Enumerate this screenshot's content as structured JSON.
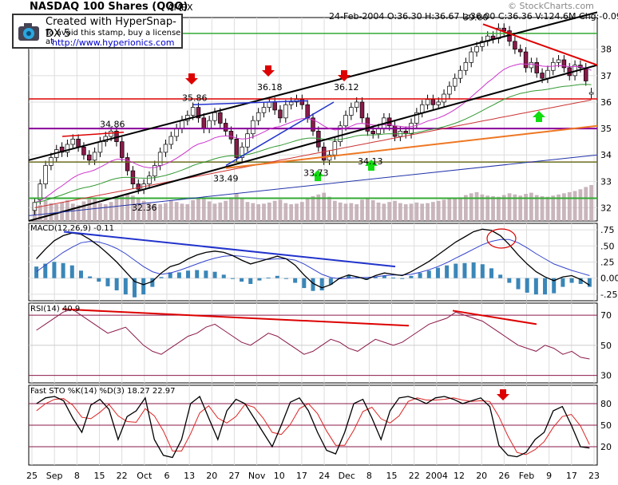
{
  "header": {
    "title": "NASDAQ 100 Shares (QQQ)",
    "exchange": "AMEX",
    "quote": "24-Feb-2004 O:36.30 H:36.67 L:36.00 C:36.36 V:124.6M Chg:-0.09",
    "copyright": "© StockCharts.com"
  },
  "stamp": {
    "line1": "Created with HyperSnap-DX 5",
    "line2": "To avoid this stamp, buy a license at",
    "line3": "http://www.hyperionics.com"
  },
  "colors": {
    "up": "#ffffff",
    "down": "#8b1a4a",
    "candle_border": "#000000",
    "ema20": "#cc33cc",
    "ema50": "#339933",
    "ema200": "#cc3333",
    "red_line": "#dd0000",
    "purple_line": "#880099",
    "green_line": "#33aa33",
    "orange_line": "#ee7722",
    "blue_line": "#2233cc",
    "arrow_down": "#dd0000",
    "arrow_up": "#11dd11",
    "volume": "#c0a8b0",
    "hist": "#3a86b8"
  },
  "chart_data": [
    {
      "type": "candlestick",
      "title": "NASDAQ 100 Shares (QQQ)",
      "ylim": [
        31.5,
        39.2
      ],
      "yticks": [
        32,
        33,
        34,
        35,
        36,
        37,
        38
      ],
      "x_labels": [
        "25",
        "Sep",
        "8",
        "15",
        "22",
        "Oct",
        "6",
        "13",
        "20",
        "27",
        "Nov",
        "10",
        "17",
        "24",
        "Dec",
        "8",
        "15",
        "22",
        "2004",
        "12",
        "20",
        "26",
        "Feb",
        "9",
        "17",
        "23"
      ],
      "annotations": [
        "34.86",
        "35.86",
        "36.18",
        "36.12",
        "39.00",
        "33.49",
        "33.73",
        "34.13",
        "32.36"
      ],
      "series": [
        {
          "name": "close",
          "values": [
            32.2,
            32.9,
            33.6,
            33.9,
            34.2,
            34.1,
            34.4,
            34.6,
            34.3,
            34.0,
            33.8,
            34.1,
            34.5,
            34.7,
            34.9,
            34.5,
            33.9,
            33.4,
            32.9,
            32.7,
            32.9,
            33.2,
            33.6,
            34.1,
            34.4,
            34.7,
            35.0,
            35.3,
            35.5,
            35.8,
            35.4,
            35.0,
            35.3,
            35.6,
            35.2,
            34.9,
            34.6,
            33.9,
            34.3,
            34.8,
            35.3,
            35.6,
            35.8,
            36.0,
            35.7,
            35.4,
            35.9,
            36.0,
            36.1,
            35.9,
            35.4,
            34.9,
            34.3,
            33.8,
            34.0,
            34.5,
            35.1,
            35.5,
            35.8,
            36.0,
            35.4,
            34.9,
            34.8,
            35.0,
            35.4,
            35.1,
            34.7,
            34.9,
            34.8,
            35.2,
            35.6,
            35.9,
            36.1,
            35.9,
            36.0,
            36.3,
            36.6,
            36.9,
            37.2,
            37.5,
            37.9,
            38.1,
            38.3,
            38.5,
            38.4,
            38.8,
            38.7,
            38.3,
            38.0,
            37.9,
            37.3,
            37.5,
            37.1,
            36.9,
            37.2,
            37.5,
            37.6,
            37.3,
            37.0,
            37.4,
            37.3,
            36.8,
            36.36
          ]
        },
        {
          "name": "open",
          "values": [
            31.9,
            32.3,
            32.9,
            33.6,
            33.9,
            34.3,
            34.1,
            34.4,
            34.6,
            34.3,
            34.0,
            33.8,
            34.1,
            34.5,
            34.7,
            34.9,
            34.5,
            33.9,
            33.4,
            32.9,
            32.7,
            32.9,
            33.2,
            33.6,
            34.1,
            34.4,
            34.7,
            35.0,
            35.3,
            35.5,
            35.8,
            35.4,
            35.0,
            35.3,
            35.6,
            35.2,
            34.9,
            34.6,
            33.9,
            34.3,
            34.8,
            35.3,
            35.6,
            35.8,
            36.0,
            35.7,
            35.4,
            35.9,
            36.0,
            36.1,
            35.9,
            35.4,
            34.9,
            34.3,
            33.8,
            34.0,
            34.5,
            35.1,
            35.5,
            35.8,
            36.0,
            35.4,
            34.9,
            34.8,
            35.0,
            35.4,
            35.1,
            34.7,
            34.9,
            34.8,
            35.2,
            35.6,
            35.9,
            36.1,
            35.9,
            36.0,
            36.3,
            36.6,
            36.9,
            37.2,
            37.5,
            37.9,
            38.1,
            38.3,
            38.5,
            38.4,
            38.8,
            38.7,
            38.3,
            38.0,
            37.9,
            37.3,
            37.5,
            37.1,
            36.9,
            37.2,
            37.5,
            37.6,
            37.3,
            37.0,
            37.4,
            37.3,
            36.3
          ]
        },
        {
          "name": "volume_m",
          "values": [
            60,
            55,
            70,
            62,
            58,
            65,
            72,
            60,
            55,
            68,
            75,
            80,
            62,
            58,
            66,
            85,
            90,
            95,
            88,
            78,
            70,
            64,
            60,
            58,
            62,
            70,
            66,
            60,
            58,
            72,
            80,
            76,
            68,
            60,
            64,
            70,
            82,
            95,
            80,
            66,
            62,
            58,
            60,
            64,
            70,
            74,
            62,
            58,
            60,
            66,
            78,
            86,
            92,
            98,
            84,
            70,
            64,
            60,
            62,
            58,
            74,
            80,
            72,
            64,
            60,
            66,
            70,
            62,
            58,
            60,
            64,
            60,
            62,
            66,
            70,
            74,
            78,
            80,
            82,
            90,
            96,
            100,
            92,
            88,
            86,
            84,
            90,
            96,
            92,
            88,
            94,
            98,
            90,
            86,
            84,
            88,
            92,
            96,
            100,
            104,
            110,
            118,
            124.6
          ]
        }
      ]
    },
    {
      "type": "line",
      "title": "MACD(12,26,9) -0.11",
      "ylim": [
        -0.35,
        0.85
      ],
      "yticks": [
        ".75",
        ".50",
        ".25",
        "0.00",
        "-.25"
      ],
      "series": [
        {
          "name": "MACD",
          "values": [
            0.3,
            0.45,
            0.58,
            0.66,
            0.7,
            0.68,
            0.6,
            0.5,
            0.38,
            0.25,
            0.1,
            -0.05,
            -0.1,
            -0.05,
            0.08,
            0.18,
            0.22,
            0.3,
            0.36,
            0.4,
            0.42,
            0.4,
            0.35,
            0.28,
            0.22,
            0.26,
            0.3,
            0.34,
            0.3,
            0.2,
            0.05,
            -0.08,
            -0.15,
            -0.1,
            0.0,
            0.05,
            0.02,
            -0.02,
            0.04,
            0.08,
            0.06,
            0.04,
            0.1,
            0.18,
            0.26,
            0.36,
            0.46,
            0.56,
            0.64,
            0.72,
            0.76,
            0.74,
            0.66,
            0.52,
            0.36,
            0.22,
            0.1,
            0.02,
            -0.04,
            0.02,
            0.04,
            -0.02,
            -0.11
          ]
        },
        {
          "name": "Signal",
          "values": [
            0.1,
            0.2,
            0.3,
            0.4,
            0.48,
            0.55,
            0.57,
            0.56,
            0.52,
            0.46,
            0.38,
            0.28,
            0.18,
            0.1,
            0.06,
            0.08,
            0.12,
            0.17,
            0.22,
            0.27,
            0.31,
            0.34,
            0.35,
            0.34,
            0.32,
            0.3,
            0.29,
            0.3,
            0.3,
            0.28,
            0.22,
            0.14,
            0.06,
            0.01,
            -0.01,
            0.0,
            0.01,
            0.01,
            0.02,
            0.04,
            0.05,
            0.05,
            0.06,
            0.09,
            0.13,
            0.18,
            0.24,
            0.31,
            0.38,
            0.45,
            0.52,
            0.57,
            0.6,
            0.6,
            0.55,
            0.47,
            0.38,
            0.3,
            0.22,
            0.17,
            0.12,
            0.08,
            0.04
          ]
        }
      ]
    },
    {
      "type": "line",
      "title": "RSI(14) 40.9",
      "ylim": [
        25,
        78
      ],
      "yticks": [
        70,
        50,
        30
      ],
      "series": [
        {
          "name": "RSI",
          "values": [
            60,
            64,
            68,
            72,
            74,
            70,
            66,
            62,
            58,
            60,
            62,
            56,
            50,
            46,
            44,
            48,
            52,
            56,
            58,
            62,
            64,
            60,
            56,
            52,
            50,
            54,
            58,
            56,
            52,
            48,
            44,
            46,
            50,
            54,
            52,
            48,
            46,
            50,
            54,
            52,
            50,
            52,
            56,
            60,
            64,
            66,
            68,
            72,
            70,
            68,
            66,
            62,
            58,
            54,
            50,
            48,
            46,
            50,
            48,
            44,
            46,
            42,
            40.9
          ]
        }
      ]
    },
    {
      "type": "line",
      "title": "Fast STO %K(14) %D(3) 18.27 22.97",
      "ylim": [
        0,
        100
      ],
      "yticks": [
        80,
        50,
        20
      ],
      "series": [
        {
          "name": "%K",
          "values": [
            80,
            88,
            90,
            84,
            60,
            40,
            78,
            86,
            72,
            30,
            62,
            70,
            88,
            30,
            8,
            5,
            30,
            80,
            90,
            60,
            30,
            70,
            86,
            80,
            60,
            40,
            20,
            50,
            82,
            88,
            70,
            40,
            15,
            10,
            40,
            80,
            86,
            60,
            30,
            70,
            88,
            90,
            86,
            80,
            88,
            90,
            86,
            80,
            84,
            88,
            76,
            22,
            8,
            6,
            12,
            30,
            40,
            70,
            76,
            50,
            20,
            18.27
          ]
        },
        {
          "name": "%D",
          "values": [
            70,
            80,
            86,
            87,
            78,
            61,
            59,
            68,
            79,
            63,
            55,
            54,
            73,
            63,
            42,
            14,
            14,
            38,
            67,
            77,
            60,
            53,
            62,
            79,
            75,
            60,
            40,
            37,
            51,
            73,
            80,
            66,
            42,
            22,
            22,
            43,
            69,
            75,
            59,
            53,
            63,
            83,
            88,
            85,
            85,
            86,
            88,
            85,
            83,
            84,
            83,
            62,
            35,
            12,
            9,
            16,
            27,
            47,
            62,
            65,
            49,
            22.97
          ]
        }
      ]
    }
  ]
}
